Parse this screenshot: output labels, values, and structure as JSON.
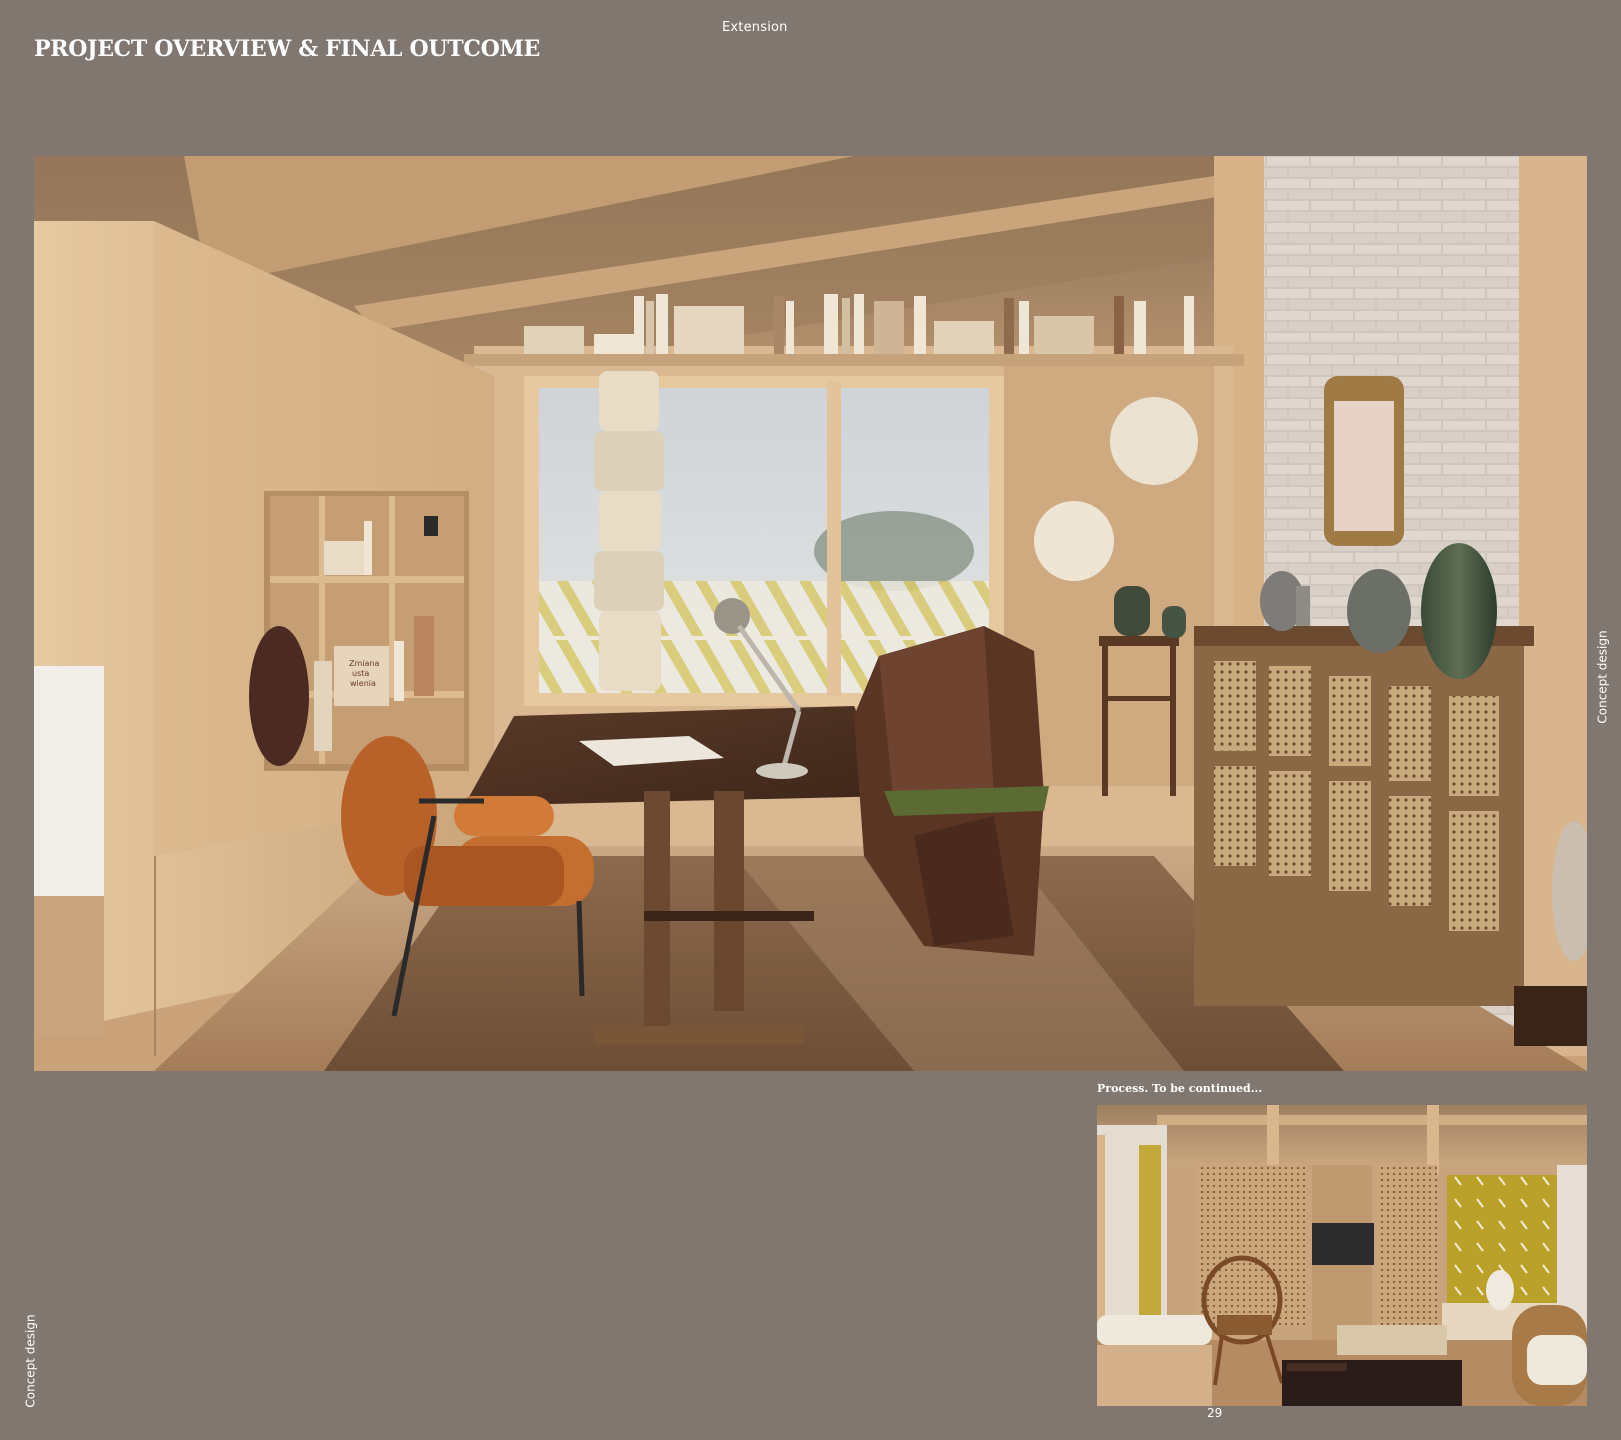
{
  "header": {
    "section": "Extension",
    "title": "PROJECT OVERVIEW & FINAL OUTCOME"
  },
  "main_image": {
    "book_title": "Zmiana\nusta\nwienia"
  },
  "caption": "Process. To be continued...",
  "side_labels": {
    "right": "Concept design",
    "left": "Concept design"
  },
  "page_number": "29",
  "colors": {
    "background": "#807870",
    "text": "#ffffff"
  }
}
